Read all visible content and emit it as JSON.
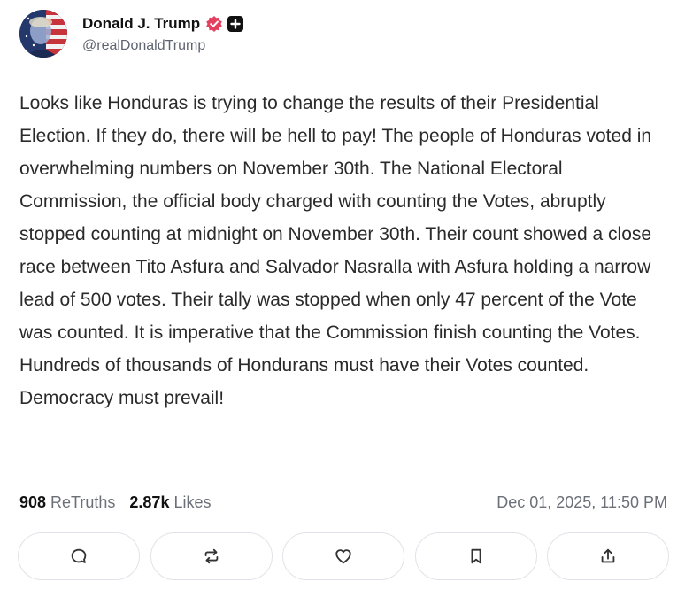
{
  "author": {
    "display_name": "Donald J. Trump",
    "handle": "@realDonaldTrump",
    "verified_color": "#e4405f"
  },
  "post": {
    "text": "Looks like Honduras is trying to change the results of their Presidential Election. If they do, there will be hell to pay! The people of Honduras voted in overwhelming numbers on November 30th. The National Electoral Commission, the official body charged with counting the Votes, abruptly stopped counting at midnight on November 30th. Their count showed a close race between Tito Asfura and Salvador Nasralla with Asfura holding a narrow lead of 500 votes. Their tally was stopped when only 47 percent of the Vote was counted. It is imperative that the Commission finish counting the Votes. Hundreds of thousands of Hondurans must have their Votes counted. Democracy must prevail!"
  },
  "stats": {
    "retruths_count": "908",
    "retruths_label": "ReTruths",
    "likes_count": "2.87k",
    "likes_label": "Likes",
    "timestamp": "Dec 01, 2025, 11:50 PM"
  },
  "actions": [
    {
      "icon": "reply-icon"
    },
    {
      "icon": "retruth-icon"
    },
    {
      "icon": "like-icon"
    },
    {
      "icon": "bookmark-icon"
    },
    {
      "icon": "share-icon"
    }
  ]
}
